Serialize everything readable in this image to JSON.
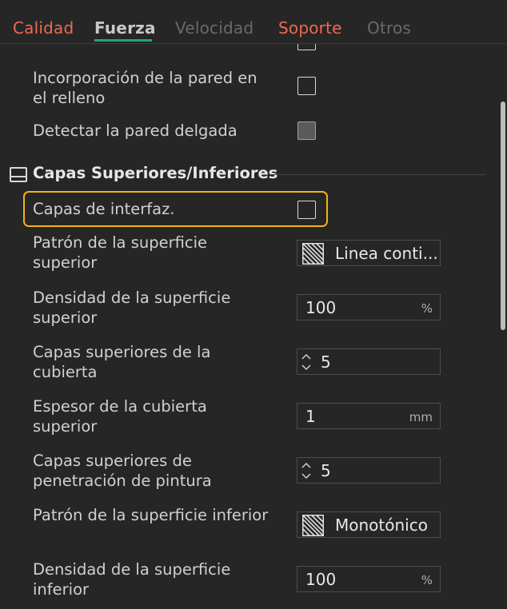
{
  "tabs": [
    {
      "label": "Calidad"
    },
    {
      "label": "Fuerza"
    },
    {
      "label": "Velocidad"
    },
    {
      "label": "Soporte"
    },
    {
      "label": "Otros"
    }
  ],
  "active_tab": "Fuerza",
  "settings": {
    "wall_infill": {
      "label": "Incorporación de la pared en el relleno",
      "checked": false
    },
    "thin_wall": {
      "label": "Detectar la pared delgada",
      "checked": false,
      "disabled": true
    },
    "section_title": "Capas Superiores/Inferiores",
    "interface_layers": {
      "label": "Capas de interfaz.",
      "checked": false
    },
    "top_pattern": {
      "label": "Patrón de la superficie superior",
      "value": "Linea conti..."
    },
    "top_density": {
      "label": "Densidad de la superficie superior",
      "value": "100",
      "unit": "%"
    },
    "top_shell_layers": {
      "label": "Capas superiores de la cubierta",
      "value": "5"
    },
    "top_shell_thickness": {
      "label": "Espesor de la cubierta superior",
      "value": "1",
      "unit": "mm"
    },
    "top_paint_layers": {
      "label": "Capas superiores de penetración de pintura",
      "value": "5"
    },
    "bottom_pattern": {
      "label": "Patrón de la superficie inferior",
      "value": "Monotónico"
    },
    "bottom_density": {
      "label": "Densidad de la superficie inferior",
      "value": "100",
      "unit": "%"
    }
  },
  "colors": {
    "background": "#262626",
    "tab_accent": "#ee6a4c",
    "active_underline": "#21a57a",
    "highlight": "#f2b413"
  },
  "icons": {
    "section": "layers-section-icon",
    "pattern": "hatch-pattern-icon",
    "spinner": "up-down-spinner-icon"
  }
}
